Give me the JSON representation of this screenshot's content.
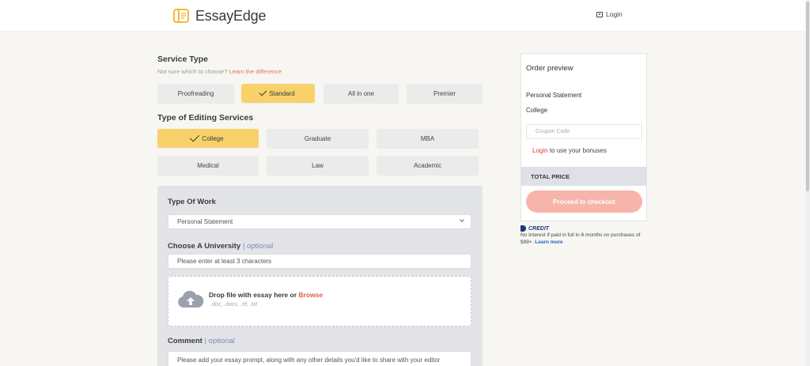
{
  "brand": {
    "name": "EssayEdge",
    "accent": "#f5b83d"
  },
  "header": {
    "login_label": "Login"
  },
  "service_type": {
    "title": "Service Type",
    "subtitle": "Not sure which to choose?",
    "subtitle_link": "Learn the difference",
    "options": [
      "Proofreading",
      "Standard",
      "All in one",
      "Premier"
    ],
    "selected": "Standard"
  },
  "editing_services": {
    "title": "Type of Editing Services",
    "options": [
      "College",
      "Graduate",
      "MBA",
      "Medical",
      "Law",
      "Academic"
    ],
    "selected": "College"
  },
  "form": {
    "type_of_work": {
      "label": "Type Of Work",
      "value": "Personal Statement"
    },
    "university": {
      "label": "Choose A University",
      "optional": "| optional",
      "placeholder": "Please enter at least 3 characters"
    },
    "upload": {
      "text": "Drop file with essay here or",
      "browse": "Browse",
      "types": ".doc, .docx, .rtf, .txt"
    },
    "comment": {
      "label": "Comment",
      "optional": "| optional",
      "placeholder": "Please add your essay prompt, along with any other details you'd like to share with your editor"
    }
  },
  "order_preview": {
    "title": "Order preview",
    "work": "Personal Statement",
    "level": "College",
    "coupon_placeholder": "Coupon Code",
    "login_link": "Login",
    "login_text": "to use your bonuses",
    "total_label": "TOTAL PRICE",
    "checkout_label": "Proceed to checkout"
  },
  "paypal": {
    "logo_text": "CREDIT",
    "text": "No Interest if paid in full in 6 months on purchases of $99+.",
    "link": "Learn more"
  }
}
